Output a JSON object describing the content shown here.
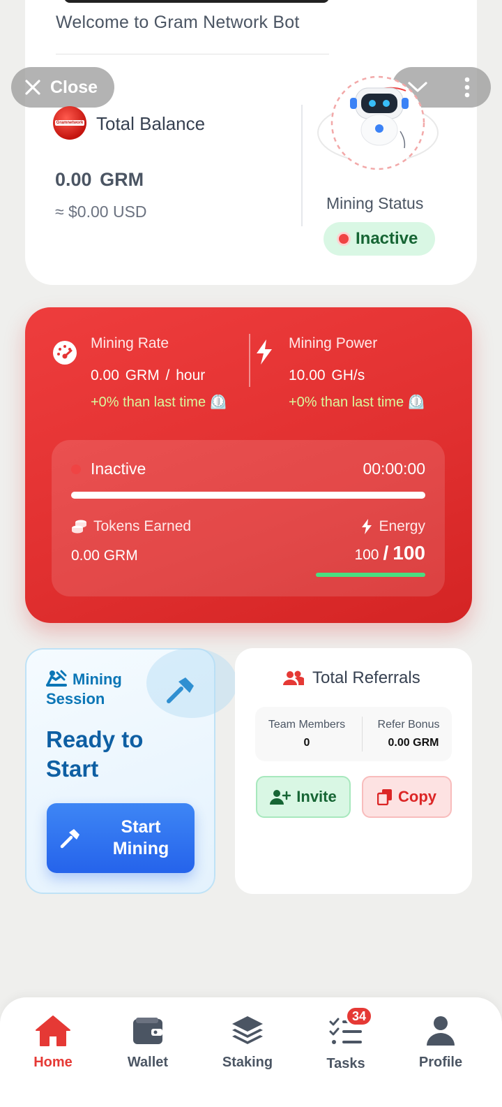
{
  "header": {
    "welcome": "Welcome to Gram Network Bot",
    "close_label": "Close"
  },
  "balance": {
    "title": "Total Balance",
    "logo_text": "Gramnetwork",
    "amount": "0.00",
    "unit": "GRM",
    "usd": "≈ $0.00 USD"
  },
  "mining_status": {
    "label": "Mining Status",
    "status": "Inactive"
  },
  "mining_card": {
    "rate_title": "Mining Rate",
    "rate_value": "0.00",
    "rate_unit": "GRM / hour",
    "rate_change": "+0% than last time ⏲️",
    "power_title": "Mining Power",
    "power_value": "10.00",
    "power_unit": "GH/s",
    "power_change": "+0% than last time ⏲️",
    "session_status": "Inactive",
    "timer": "00:00:00",
    "progress": 1.0,
    "tokens_label": "Tokens Earned",
    "tokens_value": "0.00 GRM",
    "energy_label": "Energy",
    "energy_current": "100",
    "energy_sep": "/",
    "energy_max": "100",
    "energy_fraction": 1.0
  },
  "session": {
    "title": "Mining Session",
    "ready": "Ready to Start",
    "button": "Start Mining"
  },
  "referrals": {
    "title": "Total Referrals",
    "team_label": "Team Members",
    "team_value": "0",
    "bonus_label": "Refer Bonus",
    "bonus_value": "0.00 GRM",
    "invite": "Invite",
    "copy": "Copy"
  },
  "nav": {
    "home": "Home",
    "wallet": "Wallet",
    "staking": "Staking",
    "tasks": "Tasks",
    "tasks_badge": "34",
    "profile": "Profile"
  },
  "colors": {
    "accent_red": "#e53935",
    "mining_card": "#e43434",
    "status_green": "#166534",
    "blue_button": "#2563eb"
  },
  "icons": [
    "close-icon",
    "chevron-down-icon",
    "more-vertical-icon",
    "robot-icon",
    "speedometer-icon",
    "bolt-icon",
    "coins-icon",
    "miner-icon",
    "hammer-icon",
    "users-icon",
    "user-plus-icon",
    "copy-icon",
    "home-icon",
    "wallet-icon",
    "layers-icon",
    "tasks-icon",
    "user-icon"
  ]
}
